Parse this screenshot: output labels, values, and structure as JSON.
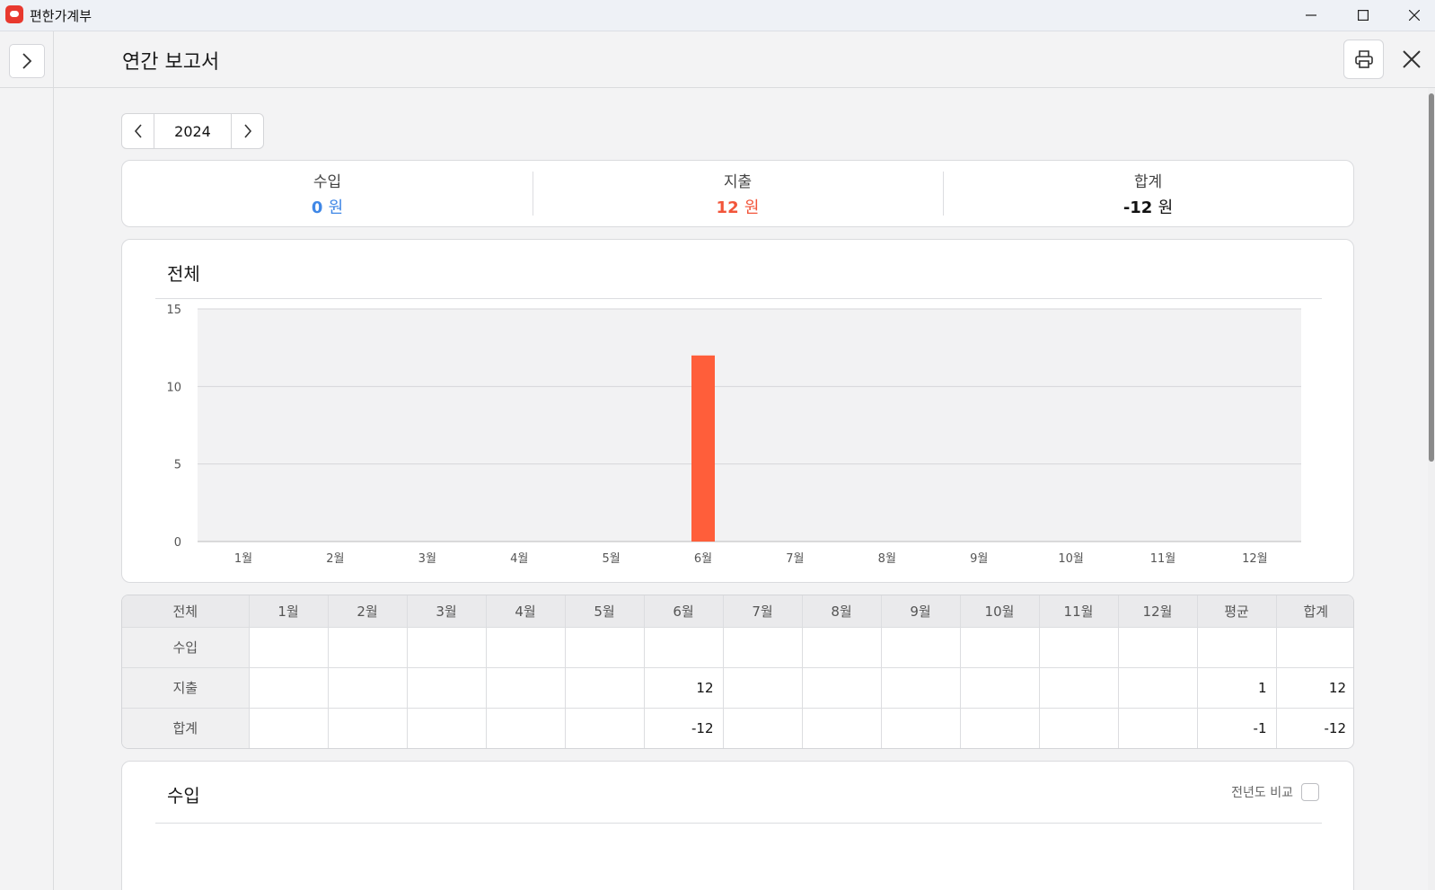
{
  "app": {
    "title": "편한가계부"
  },
  "header": {
    "title": "연간 보고서"
  },
  "year_selector": {
    "year": "2024"
  },
  "summary": [
    {
      "label": "수입",
      "value": "0",
      "unit": "원",
      "color": "#3f87e6"
    },
    {
      "label": "지출",
      "value": "12",
      "unit": "원",
      "color": "#f2553a"
    },
    {
      "label": "합계",
      "value": "-12",
      "unit": "원",
      "color": "#111111"
    }
  ],
  "chart_card": {
    "title": "전체"
  },
  "chart_data": {
    "type": "bar",
    "categories": [
      "1월",
      "2월",
      "3월",
      "4월",
      "5월",
      "6월",
      "7월",
      "8월",
      "9월",
      "10월",
      "11월",
      "12월"
    ],
    "values": [
      0,
      0,
      0,
      0,
      0,
      12,
      0,
      0,
      0,
      0,
      0,
      0
    ],
    "ylim": [
      0,
      15
    ],
    "yticks": [
      0,
      5,
      10,
      15
    ],
    "grid": true,
    "bar_color": "#ff5e3a"
  },
  "table": {
    "headers": [
      "전체",
      "1월",
      "2월",
      "3월",
      "4월",
      "5월",
      "6월",
      "7월",
      "8월",
      "9월",
      "10월",
      "11월",
      "12월",
      "평균",
      "합계"
    ],
    "rows": [
      {
        "label": "수입",
        "cells": [
          "",
          "",
          "",
          "",
          "",
          "",
          "",
          "",
          "",
          "",
          "",
          "",
          "",
          ""
        ]
      },
      {
        "label": "지출",
        "cells": [
          "",
          "",
          "",
          "",
          "",
          "12",
          "",
          "",
          "",
          "",
          "",
          "",
          "1",
          "12"
        ]
      },
      {
        "label": "합계",
        "cells": [
          "",
          "",
          "",
          "",
          "",
          "-12",
          "",
          "",
          "",
          "",
          "",
          "",
          "-1",
          "-12"
        ]
      }
    ]
  },
  "income_card": {
    "title": "수입",
    "compare_label": "전년도 비교"
  }
}
